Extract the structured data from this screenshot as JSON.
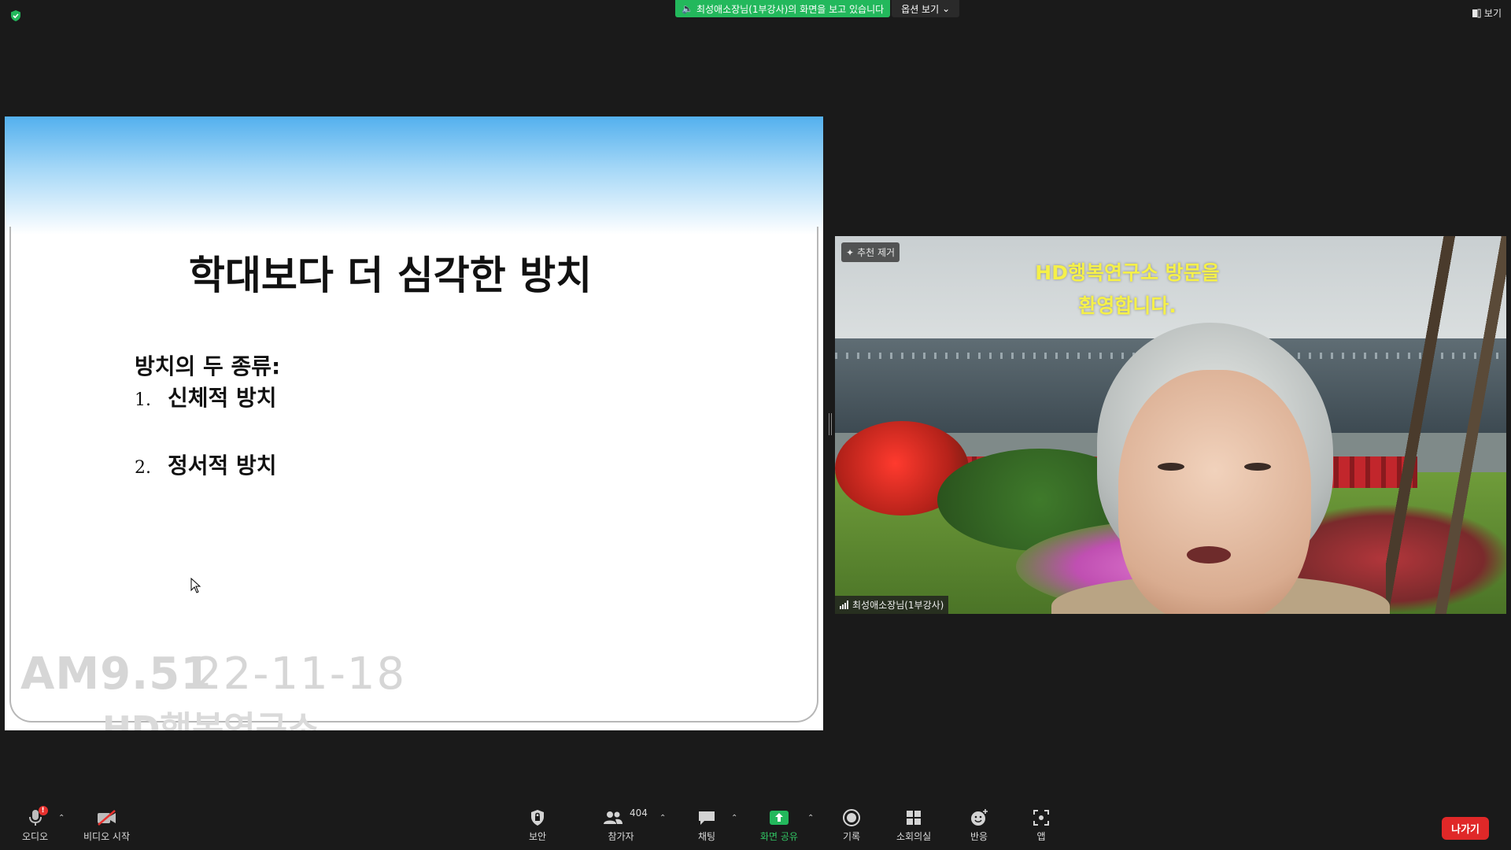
{
  "top": {
    "viewing_banner": "최성애소장님(1부강사)의 화면을 보고 있습니다",
    "view_options": "옵션 보기",
    "view_button": "보기"
  },
  "slide": {
    "title": "학대보다 더 심각한 방치",
    "subtitle": "방치의 두 종류:",
    "items": [
      {
        "num": "1.",
        "text": "신체적 방치"
      },
      {
        "num": "2.",
        "text": "정서적 방치"
      }
    ],
    "watermark_time": "AM9.51",
    "watermark_date": "22-11-18",
    "watermark_brand": "HD행복연구소"
  },
  "video": {
    "welcome_line1": "HD행복연구소 방문을",
    "welcome_line2": "환영합니다.",
    "pin_label": "추천 제거",
    "participant_name": "최성애소장님(1부강사)"
  },
  "toolbar": {
    "audio": "오디오",
    "audio_badge": "!",
    "video": "비디오 시작",
    "security": "보안",
    "participants": "참가자",
    "participants_count": "404",
    "chat": "채팅",
    "share_screen": "화면 공유",
    "record": "기록",
    "breakout": "소회의실",
    "reactions": "반응",
    "apps": "앱",
    "leave": "나가기"
  },
  "colors": {
    "share_green": "#23b85c",
    "leave_red": "#e02828",
    "welcome_yellow": "#f5f049"
  }
}
